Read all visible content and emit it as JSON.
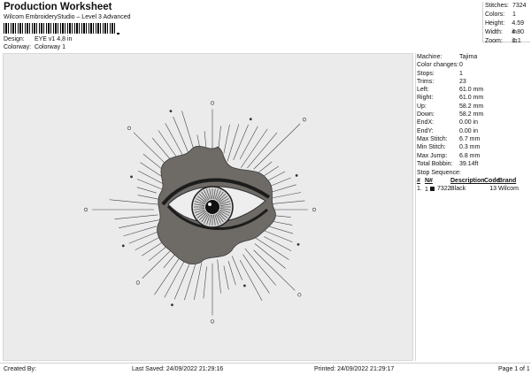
{
  "header": {
    "title": "Production Worksheet",
    "subtitle": "Wilcom EmbroideryStudio – Level 3 Advanced",
    "design_label": "Design:",
    "design_value": "EYE v1 4,8 in",
    "colorway_label": "Colorway:",
    "colorway_value": "Colorway 1"
  },
  "stats": [
    {
      "label": "Stitches:",
      "value": "7324"
    },
    {
      "label": "Colors:",
      "value": "1"
    },
    {
      "label": "Height:",
      "value": "4.59 in"
    },
    {
      "label": "Width:",
      "value": "4.80 in"
    },
    {
      "label": "Zoom:",
      "value": "1:1"
    }
  ],
  "properties": [
    {
      "label": "Machine:",
      "value": "Tajima"
    },
    {
      "label": "Color changes:",
      "value": "0"
    },
    {
      "label": "Stops:",
      "value": "1"
    },
    {
      "label": "Trims:",
      "value": "23"
    },
    {
      "label": "Left:",
      "value": "61.0 mm"
    },
    {
      "label": "Right:",
      "value": "61.0 mm"
    },
    {
      "label": "Up:",
      "value": "58.2 mm"
    },
    {
      "label": "Down:",
      "value": "58.2 mm"
    },
    {
      "label": "EndX:",
      "value": "0.00 in"
    },
    {
      "label": "EndY:",
      "value": "0.00 in"
    },
    {
      "label": "Max Stitch:",
      "value": "6.7 mm"
    },
    {
      "label": "Min Stitch:",
      "value": "0.3 mm"
    },
    {
      "label": "Max Jump:",
      "value": "6.8 mm"
    },
    {
      "label": "Total Bobbin:",
      "value": "39.14ft"
    }
  ],
  "stop_sequence": {
    "title": "Stop Sequence:",
    "headers": [
      "#",
      "N#",
      "",
      "Description",
      "Code",
      "Brand"
    ],
    "rows": [
      {
        "num": "1.",
        "n": "1",
        "stitches": "7322",
        "description": "Black",
        "code": "13",
        "brand": "Wilcom",
        "color": "#1a1a1a"
      }
    ]
  },
  "footer": {
    "created": "Created By:",
    "saved": "Last Saved: 24/09/2022 21:29:16",
    "printed": "Printed: 24/09/2022 21:29:17",
    "page": "Page 1 of 1"
  },
  "colors": {
    "thread": "#2b2b2b",
    "fill": "#6e6a66",
    "canvas": "#ebebeb"
  }
}
